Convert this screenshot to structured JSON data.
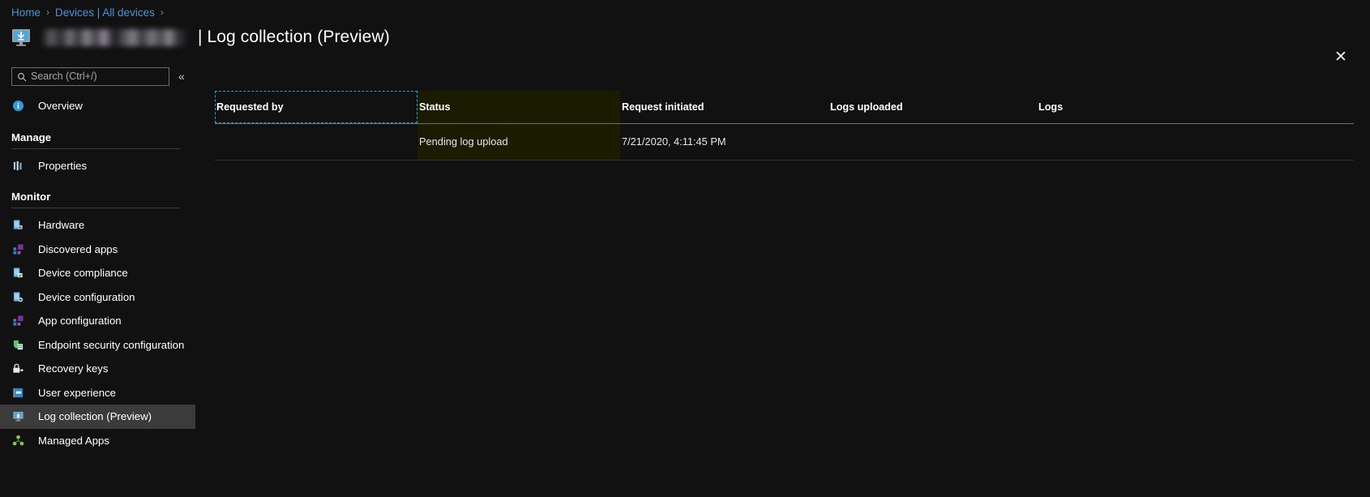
{
  "breadcrumb": {
    "items": [
      {
        "label": "Home",
        "link": true
      },
      {
        "label": "Devices | All devices",
        "link": true
      }
    ],
    "separator": "›",
    "trailing_separator": "›"
  },
  "header": {
    "icon": "monitor-download-icon",
    "device_name": "",
    "device_name_redacted": true,
    "title": "| Log collection (Preview)",
    "close_label": "✕",
    "close_icon": "close-icon"
  },
  "sidebar": {
    "search": {
      "placeholder": "Search (Ctrl+/)",
      "value": "",
      "icon": "search-icon"
    },
    "collapse": {
      "label": "«",
      "icon": "chevron-double-left-icon"
    },
    "items": [
      {
        "label": "Overview",
        "icon": "info-circle-icon",
        "type": "item",
        "selected": false
      },
      {
        "label": "Manage",
        "type": "section"
      },
      {
        "label": "Properties",
        "icon": "properties-bars-icon",
        "type": "item",
        "selected": false
      },
      {
        "label": "Monitor",
        "type": "section"
      },
      {
        "label": "Hardware",
        "icon": "hardware-device-icon",
        "type": "item",
        "selected": false
      },
      {
        "label": "Discovered apps",
        "icon": "discovered-apps-icon",
        "type": "item",
        "selected": false
      },
      {
        "label": "Device compliance",
        "icon": "device-compliance-icon",
        "type": "item",
        "selected": false
      },
      {
        "label": "Device configuration",
        "icon": "device-configuration-icon",
        "type": "item",
        "selected": false
      },
      {
        "label": "App configuration",
        "icon": "app-configuration-icon",
        "type": "item",
        "selected": false
      },
      {
        "label": "Endpoint security configuration",
        "icon": "endpoint-security-icon",
        "type": "item",
        "selected": false
      },
      {
        "label": "Recovery keys",
        "icon": "lock-key-icon",
        "type": "item",
        "selected": false
      },
      {
        "label": "User experience",
        "icon": "user-experience-icon",
        "type": "item",
        "selected": false
      },
      {
        "label": "Log collection (Preview)",
        "icon": "monitor-download-icon",
        "type": "item",
        "selected": true
      },
      {
        "label": "Managed Apps",
        "icon": "managed-apps-icon",
        "type": "item",
        "selected": false
      }
    ]
  },
  "table": {
    "columns": [
      {
        "label": "Requested by",
        "focused": true,
        "highlighted": false
      },
      {
        "label": "Status",
        "focused": false,
        "highlighted": true
      },
      {
        "label": "Request initiated",
        "focused": false,
        "highlighted": false
      },
      {
        "label": "Logs uploaded",
        "focused": false,
        "highlighted": false
      },
      {
        "label": "Logs",
        "focused": false,
        "highlighted": false
      }
    ],
    "rows": [
      {
        "requested_by": "",
        "requested_by_redacted": true,
        "status": "Pending log upload",
        "status_highlighted": true,
        "request_initiated": "7/21/2020, 4:11:45 PM",
        "logs_uploaded": "",
        "logs": ""
      }
    ]
  },
  "colors": {
    "background": "#111111",
    "link": "#4894d8",
    "highlight_text": "#ffff00",
    "highlight_bg": "#1b1b00",
    "focus_outline": "#21a8e8",
    "selected_row": "#3b3b3b"
  }
}
